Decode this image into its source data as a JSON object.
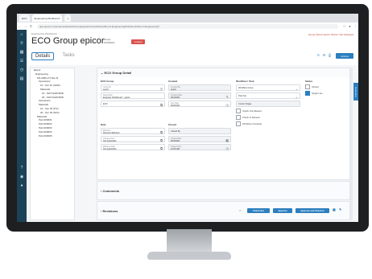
{
  "browser": {
    "tabs": [
      "ECO",
      "Engineering Workbench",
      "+"
    ],
    "url": "app.epicor.com/erp/mes/kinetic/home/apps/erp/home/#/view/Erp.UI.EngineeringWorkbench/Erp.UI.Engineering?"
  },
  "header": {
    "breadcrumb": "Engineering Workbench",
    "title": "ECO Group epicor",
    "meta_line1": "Group",
    "meta_line2": "6/19/2021",
    "badge": "Locked",
    "right_note": "Group Owner:epicor  Owner: Not Assigned",
    "action_label": "Actions"
  },
  "tabs": {
    "details": "Details",
    "tasks": "Tasks"
  },
  "tree": {
    "nodes": [
      "Epicor",
      "Engineering",
      "MA 2000-2.5 Rev B",
      "Operations",
      "10 - Opr 10 (SAW)",
      "Materials",
      "10 - MAT-SAW-BND",
      "20 - MAT-SAW-BND",
      "Operations",
      "Materials",
      "10 - Opr 20 (Pnt)",
      "20 - Opr 30 (Mch)",
      "Materials",
      "Part-000001",
      "Part-000002",
      "Part-000003",
      "Part-000004",
      "Part-000005"
    ]
  },
  "section_detail": {
    "title": "ECO Group Detail",
    "eco_group": {
      "heading": "ECO Group",
      "group_id_label": "Group ID",
      "group_id": "epicor",
      "description_label": "Description",
      "description": "Engineer Workbench - epicor",
      "eco_placeholder": "ECO"
    },
    "created": {
      "heading": "Created",
      "by_label": "Created By",
      "by": "epicor",
      "date_label": "Created Date",
      "date": "6/19/2021",
      "due_label": "Due Date",
      "due": "6/22/2021"
    },
    "workflow": {
      "heading": "Workflow / Task",
      "wf_group": "Workflow Group",
      "task": "Task Set",
      "current_stage": "Current Stage",
      "checks": [
        "Check Out Allowed",
        "Check In Allowed",
        "Workflow Complete"
      ]
    },
    "status": {
      "heading": "Status",
      "options": [
        "Closed",
        "Single Use"
      ]
    },
    "date_col": {
      "heading": "Date",
      "eff_label": "Effective",
      "eff": "Revision Effective",
      "closed_label": "Checked Out",
      "closed": "Not Applicable",
      "last_label": "Effective Date",
      "last": "Not Applicable"
    },
    "closed_col": {
      "heading": "Closed",
      "by_label": "Closed By",
      "date_label": "Closed Date",
      "date": "6/19/2021",
      "last_label": "Closed Time",
      "last": "12:00 AM"
    }
  },
  "section_comments": {
    "title": "Comments"
  },
  "section_revisions": {
    "title": "Revisions",
    "buttons": [
      "Check Out",
      "Approve",
      "Approve and Check In"
    ]
  },
  "side_tab": "Overview"
}
